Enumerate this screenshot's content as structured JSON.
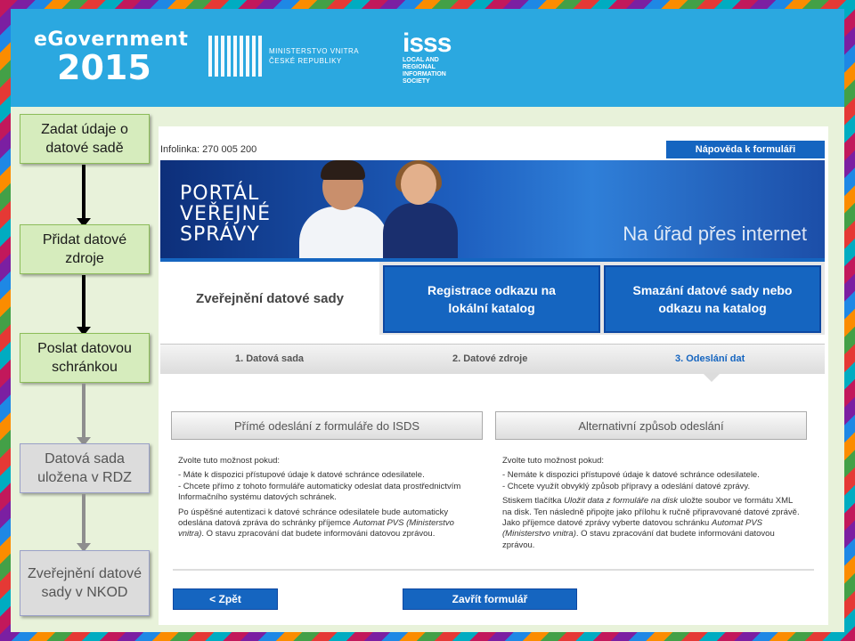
{
  "header": {
    "egov_line1": "eGovernment",
    "egov_line2": "2015",
    "ministry_line1": "MINISTERSTVO VNITRA",
    "ministry_line2": "ČESKÉ REPUBLIKY",
    "isss_logo": "isss",
    "isss_sub": "LOCAL AND REGIONAL INFORMATION SOCIETY"
  },
  "flow": {
    "steps": [
      {
        "label": "Zadat údaje o datové sadě"
      },
      {
        "label": "Přidat datové zdroje"
      },
      {
        "label": "Poslat datovou schránkou"
      },
      {
        "label": "Datová sada uložena v RDZ"
      },
      {
        "label": "Zveřejnění datové sady v NKOD"
      }
    ]
  },
  "portal": {
    "infolinka": "Infolinka: 270 005 200",
    "help_button": "Nápověda k formuláři",
    "banner_title_1": "PORTÁL",
    "banner_title_2": "VEŘEJNÉ",
    "banner_title_3": "SPRÁVY",
    "banner_slogan": "Na úřad přes internet",
    "tab_active": "Zveřejnění datové sady",
    "tab_register_1": "Registrace odkazu na",
    "tab_register_2": "lokální katalog",
    "tab_delete_1": "Smazání datové sady nebo",
    "tab_delete_2": "odkazu na katalog",
    "wizard_steps": [
      "1. Datová sada",
      "2. Datové zdroje",
      "3. Odeslání dat"
    ],
    "option_direct": "Přímé odeslání z formuláře do ISDS",
    "option_alt": "Alternativní způsob odeslání",
    "left_desc": {
      "intro": "Zvolte tuto možnost pokud:",
      "b1": "- Máte k dispozici přístupové údaje k datové schránce odesilatele.",
      "b2": "- Chcete přímo z tohoto formuláře automaticky odeslat data prostřednictvím Informačního systému datových schránek.",
      "p2_a": "Po úspěšné autentizaci k datové schránce odesilatele bude automaticky odeslána datová zpráva do schránky příjemce ",
      "p2_em": "Automat PVS (Ministerstvo vnitra)",
      "p2_b": ". O stavu zpracování dat budete informováni datovou zprávou."
    },
    "right_desc": {
      "intro": "Zvolte tuto možnost pokud:",
      "b1": "- Nemáte k dispozici přístupové údaje k datové schránce odesilatele.",
      "b2": "- Chcete využít obvyklý způsob přípravy a odeslání datové zprávy.",
      "p2_a": "Stiskem tlačítka ",
      "p2_em1": "Uložit data z formuláře na disk",
      "p2_b": " uložte soubor ve formátu XML na disk. Ten následně připojte jako přílohu k ručně připravované datové zprávě. Jako příjemce datové zprávy vyberte datovou schránku ",
      "p2_em2": "Automat PVS (Ministerstvo vnitra)",
      "p2_c": ". O stavu zpracování dat budete informováni datovou zprávou."
    },
    "back_button": "< Zpět",
    "close_button": "Zavřít formulář"
  },
  "colors": {
    "header_blue": "#2ba8e0",
    "portal_blue": "#1565c0",
    "step_green": "#d6ecbd",
    "slide_bg": "#e8f2da"
  }
}
